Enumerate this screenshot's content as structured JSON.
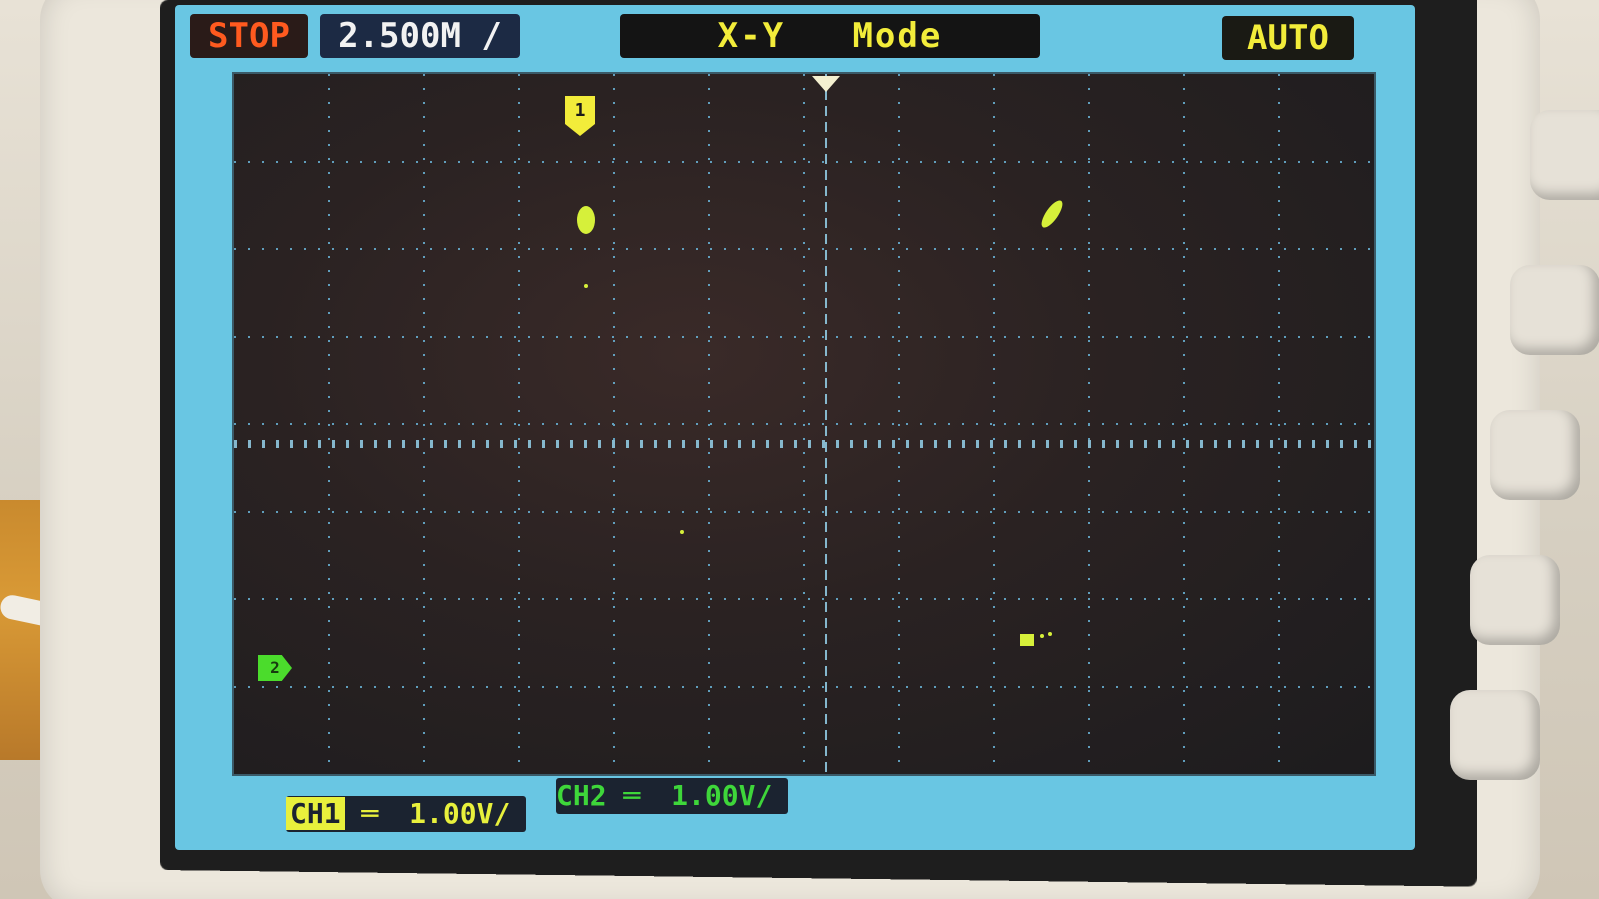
{
  "status": {
    "run_state": "STOP",
    "timebase": "2.500M",
    "mode": "X-Y   Mode",
    "trigger_mode": "AUTO"
  },
  "channels": {
    "ch1": {
      "label": "CH1",
      "scale": "1.00V/"
    },
    "ch2": {
      "label": "CH2",
      "scale": "1.00V/"
    }
  },
  "markers": {
    "ch1": "1",
    "ch2": "2"
  },
  "colors": {
    "stop": "#ff5a1f",
    "mode_text": "#f2ec3a",
    "ch1": "#e8f03c",
    "ch2": "#3ed63a",
    "grid": "#6ab4d8",
    "screen_bezel": "#69c6e3"
  },
  "grid": {
    "h_divisions": 12,
    "v_divisions": 8
  }
}
